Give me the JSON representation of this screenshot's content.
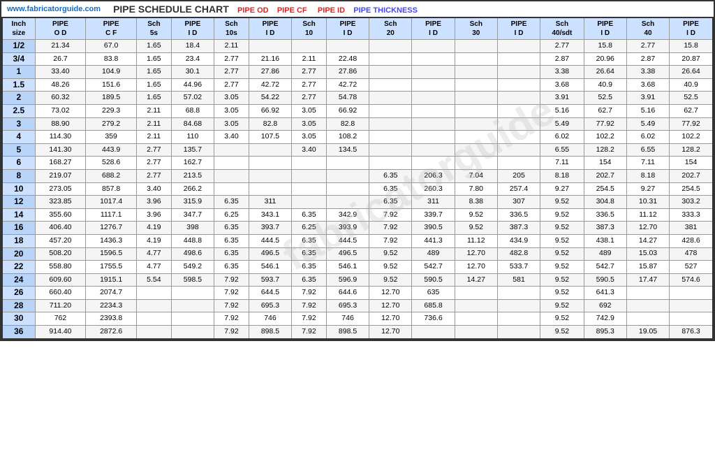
{
  "header": {
    "website": "www.fabricatorguide.com",
    "title": "PIPE SCHEDULE CHART",
    "labels": [
      "PIPE OD",
      "PIPE CF",
      "PIPE ID",
      "PIPE THICKNESS"
    ]
  },
  "columns": [
    "Inch size",
    "PIPE O D",
    "PIPE C F",
    "Sch 5s",
    "PIPE I D",
    "Sch 10s",
    "PIPE I D",
    "Sch 10",
    "PIPE I D",
    "Sch 20",
    "PIPE I D",
    "Sch 30",
    "PIPE I D",
    "Sch 40/sdt",
    "PIPE I D",
    "Sch 40",
    "PIPE I D"
  ],
  "rows": [
    [
      "1/2",
      "21.34",
      "67.0",
      "1.65",
      "18.4",
      "2.11",
      "",
      "",
      "",
      "",
      "",
      "",
      "",
      "2.77",
      "15.8",
      "2.77",
      "15.8"
    ],
    [
      "3/4",
      "26.7",
      "83.8",
      "1.65",
      "23.4",
      "2.77",
      "21.16",
      "2.11",
      "22.48",
      "",
      "",
      "",
      "",
      "2.87",
      "20.96",
      "2.87",
      "20.87"
    ],
    [
      "1",
      "33.40",
      "104.9",
      "1.65",
      "30.1",
      "2.77",
      "27.86",
      "2.77",
      "27.86",
      "",
      "",
      "",
      "",
      "3.38",
      "26.64",
      "3.38",
      "26.64"
    ],
    [
      "1.5",
      "48.26",
      "151.6",
      "1.65",
      "44.96",
      "2.77",
      "42.72",
      "2.77",
      "42.72",
      "",
      "",
      "",
      "",
      "3.68",
      "40.9",
      "3.68",
      "40.9"
    ],
    [
      "2",
      "60.32",
      "189.5",
      "1.65",
      "57.02",
      "3.05",
      "54.22",
      "2.77",
      "54.78",
      "",
      "",
      "",
      "",
      "3.91",
      "52.5",
      "3.91",
      "52.5"
    ],
    [
      "2.5",
      "73.02",
      "229.3",
      "2.11",
      "68.8",
      "3.05",
      "66.92",
      "3.05",
      "66.92",
      "",
      "",
      "",
      "",
      "5.16",
      "62.7",
      "5.16",
      "62.7"
    ],
    [
      "3",
      "88.90",
      "279.2",
      "2.11",
      "84.68",
      "3.05",
      "82.8",
      "3.05",
      "82.8",
      "",
      "",
      "",
      "",
      "5.49",
      "77.92",
      "5.49",
      "77.92"
    ],
    [
      "4",
      "114.30",
      "359",
      "2.11",
      "110",
      "3.40",
      "107.5",
      "3.05",
      "108.2",
      "",
      "",
      "",
      "",
      "6.02",
      "102.2",
      "6.02",
      "102.2"
    ],
    [
      "5",
      "141.30",
      "443.9",
      "2.77",
      "135.7",
      "",
      "",
      "3.40",
      "134.5",
      "",
      "",
      "",
      "",
      "6.55",
      "128.2",
      "6.55",
      "128.2"
    ],
    [
      "6",
      "168.27",
      "528.6",
      "2.77",
      "162.7",
      "",
      "",
      "",
      "",
      "",
      "",
      "",
      "",
      "7.11",
      "154",
      "7.11",
      "154"
    ],
    [
      "8",
      "219.07",
      "688.2",
      "2.77",
      "213.5",
      "",
      "",
      "",
      "",
      "6.35",
      "206.3",
      "7.04",
      "205",
      "8.18",
      "202.7",
      "8.18",
      "202.7"
    ],
    [
      "10",
      "273.05",
      "857.8",
      "3.40",
      "266.2",
      "",
      "",
      "",
      "",
      "6.35",
      "260.3",
      "7.80",
      "257.4",
      "9.27",
      "254.5",
      "9.27",
      "254.5"
    ],
    [
      "12",
      "323.85",
      "1017.4",
      "3.96",
      "315.9",
      "6.35",
      "311",
      "",
      "",
      "6.35",
      "311",
      "8.38",
      "307",
      "9.52",
      "304.8",
      "10.31",
      "303.2"
    ],
    [
      "14",
      "355.60",
      "1117.1",
      "3.96",
      "347.7",
      "6.25",
      "343.1",
      "6.35",
      "342.9",
      "7.92",
      "339.7",
      "9.52",
      "336.5",
      "9.52",
      "336.5",
      "11.12",
      "333.3"
    ],
    [
      "16",
      "406.40",
      "1276.7",
      "4.19",
      "398",
      "6.35",
      "393.7",
      "6.25",
      "393.9",
      "7.92",
      "390.5",
      "9.52",
      "387.3",
      "9.52",
      "387.3",
      "12.70",
      "381"
    ],
    [
      "18",
      "457.20",
      "1436.3",
      "4.19",
      "448.8",
      "6.35",
      "444.5",
      "6.35",
      "444.5",
      "7.92",
      "441.3",
      "11.12",
      "434.9",
      "9.52",
      "438.1",
      "14.27",
      "428.6"
    ],
    [
      "20",
      "508.20",
      "1596.5",
      "4.77",
      "498.6",
      "6.35",
      "496.5",
      "6.35",
      "496.5",
      "9.52",
      "489",
      "12.70",
      "482.8",
      "9.52",
      "489",
      "15.03",
      "478"
    ],
    [
      "22",
      "558.80",
      "1755.5",
      "4.77",
      "549.2",
      "6.35",
      "546.1",
      "6.35",
      "546.1",
      "9.52",
      "542.7",
      "12.70",
      "533.7",
      "9.52",
      "542.7",
      "15.87",
      "527"
    ],
    [
      "24",
      "609.60",
      "1915.1",
      "5.54",
      "598.5",
      "7.92",
      "593.7",
      "6.35",
      "596.9",
      "9.52",
      "590.5",
      "14.27",
      "581",
      "9.52",
      "590.5",
      "17.47",
      "574.6"
    ],
    [
      "26",
      "660.40",
      "2074.7",
      "",
      "",
      "7.92",
      "644.5",
      "7.92",
      "644.6",
      "12.70",
      "635",
      "",
      "",
      "9.52",
      "641.3",
      "",
      ""
    ],
    [
      "28",
      "711.20",
      "2234.3",
      "",
      "",
      "7.92",
      "695.3",
      "7.92",
      "695.3",
      "12.70",
      "685.8",
      "",
      "",
      "9.52",
      "692",
      "",
      ""
    ],
    [
      "30",
      "762",
      "2393.8",
      "",
      "",
      "7.92",
      "746",
      "7.92",
      "746",
      "12.70",
      "736.6",
      "",
      "",
      "9.52",
      "742.9",
      "",
      ""
    ],
    [
      "36",
      "914.40",
      "2872.6",
      "",
      "",
      "7.92",
      "898.5",
      "7.92",
      "898.5",
      "12.70",
      "",
      "",
      "",
      "9.52",
      "895.3",
      "19.05",
      "876.3"
    ]
  ],
  "watermark": "fabricatorguide"
}
